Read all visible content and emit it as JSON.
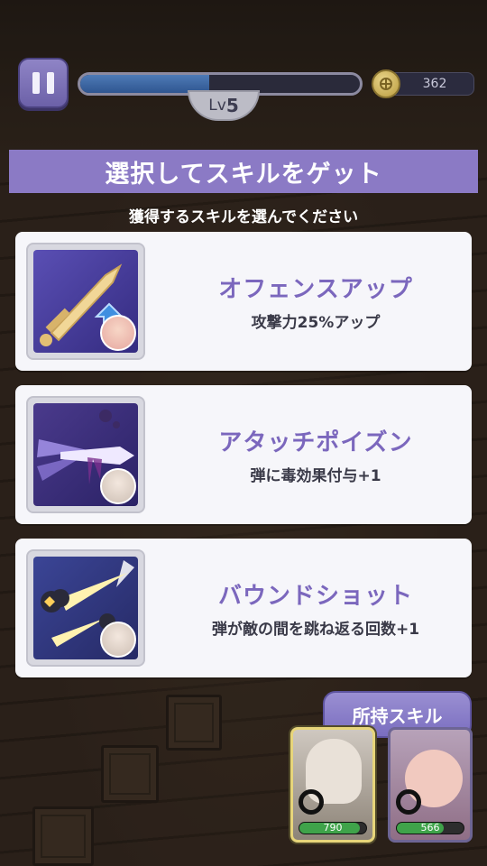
{
  "hud": {
    "level_prefix": "Lv",
    "level_value": "5",
    "xp_progress": 0.46,
    "coins": "362"
  },
  "dialog": {
    "title": "選択してスキルをゲット",
    "subtitle": "獲得するスキルを選んでください"
  },
  "skills": [
    {
      "name": "オフェンスアップ",
      "desc": "攻撃力25%アップ",
      "icon": "sword-up-icon",
      "accent": "#4a3fa0"
    },
    {
      "name": "アタッチポイズン",
      "desc": "弾に毒効果付与+1",
      "icon": "poison-arrow-icon",
      "accent": "#5b3f9a"
    },
    {
      "name": "バウンドショット",
      "desc": "弾が敵の間を跳ね返る回数+1",
      "icon": "bounce-shot-icon",
      "accent": "#3d3f8f"
    }
  ],
  "owned_skills_button": "所持スキル",
  "party": [
    {
      "hp": "790",
      "hp_ratio": 0.9,
      "selected": true
    },
    {
      "hp": "566",
      "hp_ratio": 0.7,
      "selected": false
    }
  ],
  "colors": {
    "title_banner": "#8b7ac5",
    "skill_name": "#7b67bd",
    "card_bg": "#f6f6fa"
  }
}
